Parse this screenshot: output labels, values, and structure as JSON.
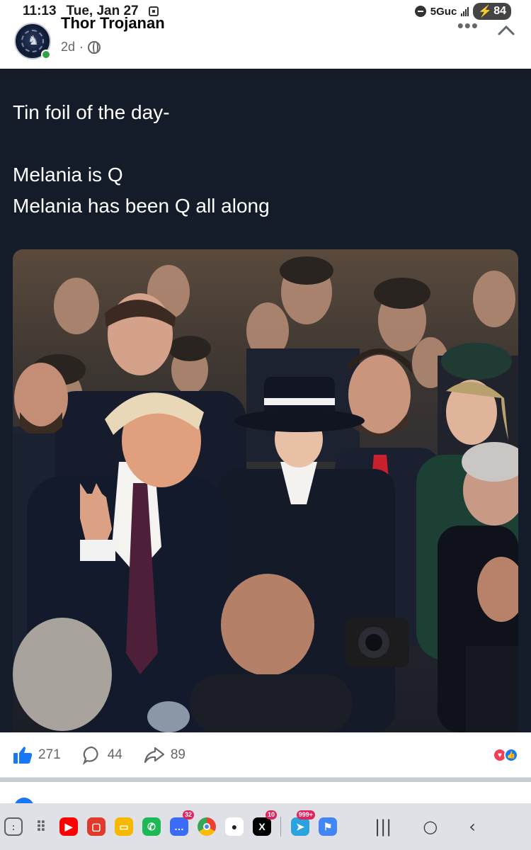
{
  "status_bar": {
    "time": "11:13",
    "date": "Tue, Jan 27",
    "network": "5Guc",
    "battery": "84"
  },
  "post": {
    "author": "Thor Trojanan",
    "age": "2d",
    "text_lines": [
      "Tin foil of the day-",
      "Melania is Q",
      "Melania has been Q all along"
    ]
  },
  "reactions": {
    "likes": "271",
    "comments": "44",
    "shares": "89"
  },
  "taskbar": {
    "apps": [
      {
        "icon": "recent-apps-icon",
        "color": "#5f6368",
        "badge": ""
      },
      {
        "icon": "app-drawer-icon",
        "color": "#5f6368",
        "badge": ""
      },
      {
        "icon": "youtube-icon",
        "color": "#ff0000",
        "badge": ""
      },
      {
        "icon": "office-icon",
        "color": "#e03a2d",
        "badge": ""
      },
      {
        "icon": "notes-icon",
        "color": "#f7b900",
        "badge": ""
      },
      {
        "icon": "phone-icon",
        "color": "#1db954",
        "badge": ""
      },
      {
        "icon": "messages-icon",
        "color": "#3b6cf6",
        "badge": "32"
      },
      {
        "icon": "chrome-icon",
        "color": "#f4b400",
        "badge": ""
      },
      {
        "icon": "camera-icon",
        "color": "#ffffff",
        "badge": ""
      },
      {
        "icon": "x-icon",
        "color": "#000000",
        "badge": "10"
      },
      {
        "icon": "telegram-icon",
        "color": "#2aa3de",
        "badge": "999+"
      },
      {
        "icon": "maps-icon",
        "color": "#4285f4",
        "badge": ""
      }
    ]
  }
}
